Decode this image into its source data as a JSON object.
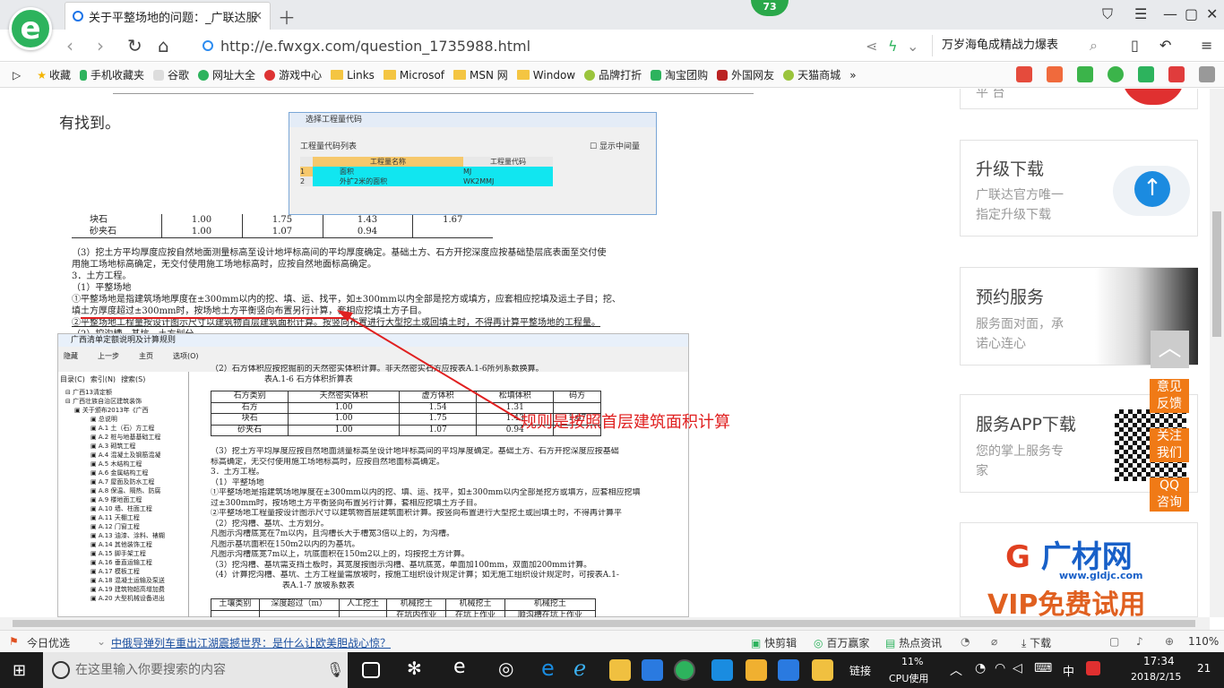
{
  "tab": {
    "title": "关于平整场地的问题：_广联达服",
    "badge": "73"
  },
  "address": {
    "url": "http://e.fwxgx.com/question_1735988.html",
    "search": "万岁海龟成精战力爆表"
  },
  "bookmarks": [
    "收藏",
    "手机收藏夹",
    "谷歌",
    "网址大全",
    "游戏中心",
    "Links",
    "Microsof",
    "MSN 网",
    "Window",
    "品牌打折",
    "淘宝团购",
    "外国网友",
    "天猫商城",
    "»"
  ],
  "article": {
    "lead": "有找到。",
    "annotation": "规则是按照首层建筑面积计算",
    "dialog": {
      "title": "选择工程量代码",
      "list_label": "工程量代码列表",
      "show_mid": "显示中间量",
      "col_name": "工程量名称",
      "col_code": "工程量代码",
      "rows": [
        [
          "1",
          "面积",
          "MJ"
        ],
        [
          "2",
          "外扩2米的面积",
          "WK2MMJ"
        ]
      ]
    },
    "scan1": {
      "rows": [
        [
          "块石",
          "1.00",
          "1.75",
          "1.43",
          "1.67"
        ],
        [
          "砂夹石",
          "1.00",
          "1.07",
          "0.94",
          ""
        ]
      ],
      "text": [
        "（3）挖土方平均厚度应按自然地面测量标高至设计地坪标高间的平均厚度确定。基础土方、石方开挖深度应按基础垫层底表面至交付使",
        "用施工场地标高确定，无交付使用施工场地标高时，应按自然地面标高确定。",
        "3．土方工程。",
        "（1）平整场地",
        "①平整场地是指建筑场地厚度在±300mm以内的挖、填、运、找平，如±300mm以内全部是挖方或填方，应套相应挖填及运土子目；挖、",
        "填土方厚度超过±300mm时，按场地土方平衡竖向布置另行计算，套相应挖填土方子目。",
        "②平整场地工程量按设计图示尺寸以建筑物首层建筑面积计算。按竖向布置进行大型挖土或回填土时，不得再计算平整场地的工程量。",
        "（2）挖沟槽、基坑、土方划分。"
      ]
    },
    "scan2": {
      "window_title": "广西清单定额说明及计算规则",
      "toolbar": [
        "隐藏",
        "上一步",
        "主页",
        "选项(O)"
      ],
      "panel_tabs": [
        "目录(C)",
        "索引(N)",
        "搜索(S)"
      ],
      "tree": [
        "广西13清定额",
        "广西壮族自治区建筑装饰",
        "关于颁布2013年《广西",
        "总说明",
        "A.1 土（石）方工程",
        "A.2 桩与地基基础工程",
        "A.3 砌筑工程",
        "A.4 混凝土及钢筋混凝",
        "A.5 木结构工程",
        "A.6 金属结构工程",
        "A.7 屋面及防水工程",
        "A.8 保温、隔热、防腐",
        "A.9 楼地面工程",
        "A.10 墙、柱面工程",
        "A.11 天棚工程",
        "A.12 门窗工程",
        "A.13 油漆、涂料、裱糊",
        "A.14 其他装饰工程",
        "A.15 脚手架工程",
        "A.16 垂直运输工程",
        "A.17 模板工程",
        "A.18 混凝土运输及泵送",
        "A.19 建筑物超高增加费",
        "A.20 大型机械设备进出"
      ],
      "top_text": "（2）石方体积应按挖掘前的天然密实体积计算。非天然密实石方应按表A.1-6所列系数换算。",
      "table_title": "表A.1-6 石方体积折算表",
      "table_head": [
        "石方类别",
        "天然密实体积",
        "虚方体积",
        "松填体积",
        "码方"
      ],
      "table_rows": [
        [
          "石方",
          "1.00",
          "1.54",
          "1.31",
          ""
        ],
        [
          "块石",
          "1.00",
          "1.75",
          "1.43",
          "1.67"
        ],
        [
          "砂夹石",
          "1.00",
          "1.07",
          "0.94",
          ""
        ]
      ],
      "text": [
        "（3）挖土方平均厚度应按自然地面测量标高至设计地坪标高间的平均厚度确定。基础土方、石方开挖深度应按基础",
        "标高确定，无交付使用施工场地标高时，应按自然地面标高确定。",
        "3．土方工程。",
        "（1）平整场地",
        "①平整场地是指建筑场地厚度在±300mm以内的挖、填、运、找平，如±300mm以内全部是挖方或填方，应套相应挖填",
        "过±300mm时，按场地土方平衡竖向布置另行计算，套相应挖填土方子目。",
        "②平整场地工程量按设计图示尺寸以建筑物首层建筑面积计算。按竖向布置进行大型挖土或回填土时，不得再计算平",
        "（2）挖沟槽、基坑、土方划分。",
        "凡图示沟槽底宽在7m以内，且沟槽长大于槽宽3倍以上的，为沟槽。",
        "凡图示基坑面积在150m2以内的为基坑。",
        "凡图示沟槽底宽7m以上，坑底面积在150m2以上的，均按挖土方计算。",
        "（3）挖沟槽、基坑需支挡土板时，其宽度按图示沟槽、基坑底宽，单面加100mm，双面加200mm计算。",
        "（4）计算挖沟槽、基坑、土方工程量需放坡时，按施工组织设计规定计算；如无施工组织设计规定时，可按表A.1-",
        "表A.1-7 放坡系数表"
      ],
      "bottom_head": [
        "土壤类别",
        "深度超过（m）",
        "人工挖土",
        "机械挖土",
        "机械挖土",
        "机械挖土"
      ],
      "bottom_sub": [
        "",
        "",
        "",
        "在坑内作业",
        "在坑上作业",
        "顺沟槽在坑上作业"
      ]
    }
  },
  "sidebar": {
    "top_partial": "平 台",
    "cards": [
      {
        "title": "升级下载",
        "desc": [
          "广联达官方唯一",
          "指定升级下载"
        ]
      },
      {
        "title": "预约服务",
        "desc": [
          "服务面对面，承",
          "诺心连心"
        ]
      },
      {
        "title": "服务APP下载",
        "desc": [
          "您的掌上服务专",
          "家"
        ]
      }
    ],
    "ad": {
      "brand": "广材网",
      "site": "www.gldjc.com",
      "vip": "VIP免费试用"
    },
    "float": [
      "意见反馈",
      "关注我们",
      "QQ咨询"
    ]
  },
  "status": {
    "left": "今日优选",
    "news": "中俄导弹列车重出江湖震撼世界：是什么让欧美胆战心惊？",
    "right": [
      "快剪辑",
      "百万赢家",
      "热点资讯",
      "下载",
      "110%"
    ]
  },
  "taskbar": {
    "search_placeholder": "在这里输入你要搜索的内容",
    "link": "链接",
    "cpu": "11%",
    "cpu_label": "CPU使用",
    "ime": "中",
    "time": "17:34",
    "date": "2018/2/15",
    "notif": "21"
  }
}
